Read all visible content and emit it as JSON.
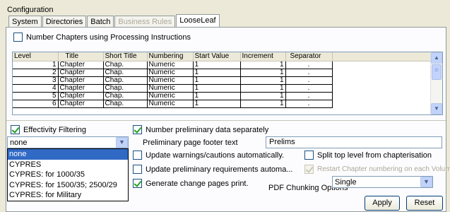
{
  "group_title": "Configuration",
  "tabs": [
    {
      "label": "System",
      "state": "normal"
    },
    {
      "label": "Directories",
      "state": "normal"
    },
    {
      "label": "Batch",
      "state": "normal"
    },
    {
      "label": "Business Rules",
      "state": "disabled"
    },
    {
      "label": "LooseLeaf",
      "state": "active"
    }
  ],
  "number_chapters": {
    "label": "Number Chapters using Processing Instructions",
    "checked": false
  },
  "table": {
    "columns": [
      "Level",
      "Title",
      "Short Title",
      "Numbering",
      "Start Value",
      "Increment",
      "Separator"
    ],
    "rows": [
      {
        "level": "1",
        "title": "Chapter",
        "short": "Chap.",
        "numbering": "Numeric",
        "start": "1",
        "increment": "1",
        "separator": "."
      },
      {
        "level": "2",
        "title": "Chapter",
        "short": "Chap.",
        "numbering": "Numeric",
        "start": "1",
        "increment": "1",
        "separator": "."
      },
      {
        "level": "3",
        "title": "Chapter",
        "short": "Chap.",
        "numbering": "Numeric",
        "start": "1",
        "increment": "1",
        "separator": "."
      },
      {
        "level": "4",
        "title": "Chapter",
        "short": "Chap.",
        "numbering": "Numeric",
        "start": "1",
        "increment": "1",
        "separator": "."
      },
      {
        "level": "5",
        "title": "Chapter",
        "short": "Chap.",
        "numbering": "Numeric",
        "start": "1",
        "increment": "1",
        "separator": "."
      },
      {
        "level": "6",
        "title": "Chapter",
        "short": "Chap.",
        "numbering": "Numeric",
        "start": "1",
        "increment": "1",
        "separator": "."
      }
    ]
  },
  "effectivity": {
    "label": "Effectivity Filtering",
    "checked": true,
    "selected": "none",
    "options": [
      "none",
      "CYPRES",
      "CYPRES: for 1000/35",
      "CYPRES: for 1500/35; 2500/29",
      "CYPRES: for Military"
    ]
  },
  "number_prelim": {
    "label": "Number preliminary data separately",
    "checked": true
  },
  "prelim_footer": {
    "label": "Preliminary page footer text",
    "value": "Prelims"
  },
  "update_warnings": {
    "label": "Update warnings/cautions automatically.",
    "checked": false
  },
  "update_prelim": {
    "label": "Update preliminary requirements automa...",
    "checked": false
  },
  "generate_change": {
    "label": "Generate change pages print.",
    "checked": true
  },
  "split_top": {
    "label": "Split top level from chapterisation",
    "checked": false
  },
  "restart_chapter": {
    "label": "Restart Chapter numbering on each Volume",
    "checked": true,
    "enabled": false
  },
  "pdf_chunking": {
    "label": "PDF Chunking Options",
    "value": "Single"
  },
  "buttons": {
    "apply": "Apply",
    "reset": "Reset"
  },
  "icons": {
    "dropdown": "chevron-down-icon",
    "scroll_up": "scroll-up-icon",
    "scroll_down": "scroll-down-icon"
  }
}
